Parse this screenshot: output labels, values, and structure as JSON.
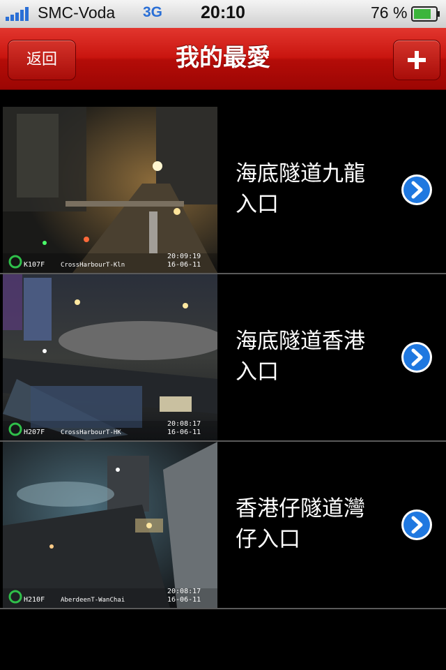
{
  "status_bar": {
    "carrier": "SMC-Voda",
    "network": "3G",
    "time": "20:10",
    "battery_percent": "76 %"
  },
  "navbar": {
    "back_label": "返回",
    "title": "我的最愛",
    "add_icon": "plus-icon"
  },
  "cameras": [
    {
      "name": "海底隧道九龍入口",
      "code": "K107F",
      "location": "CrossHarbourT-Kln",
      "time": "20:09:19",
      "date": "16-06-11"
    },
    {
      "name": "海底隧道香港入口",
      "code": "H207F",
      "location": "CrossHarbourT-HK",
      "time": "20:08:17",
      "date": "16-06-11"
    },
    {
      "name": "香港仔隧道灣仔入口",
      "code": "H210F",
      "location": "AberdeenT-WanChai",
      "time": "20:08:17",
      "date": "16-06-11"
    }
  ],
  "colors": {
    "navbar_red": "#c9150f",
    "accent_blue": "#1f78e0",
    "network_blue": "#2a6fd6"
  }
}
